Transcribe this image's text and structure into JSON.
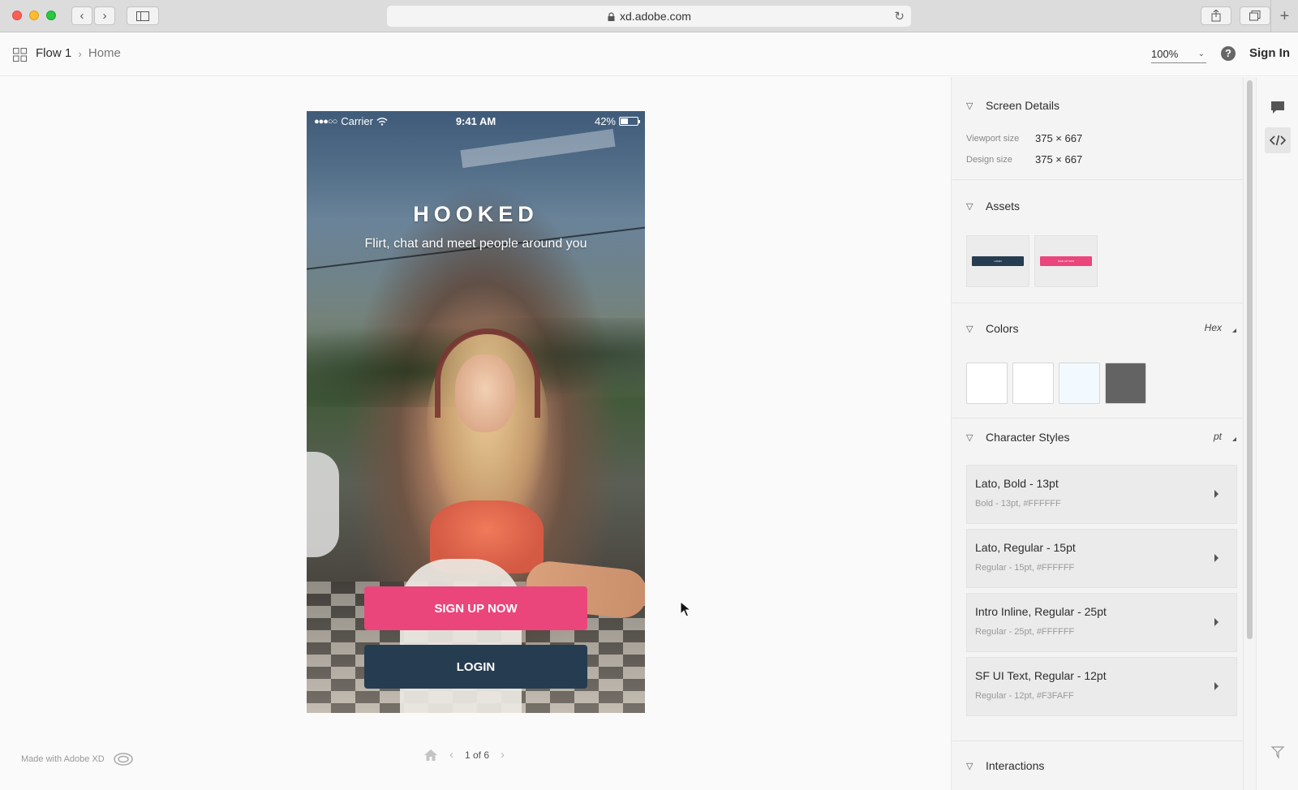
{
  "browser": {
    "url": "xd.adobe.com"
  },
  "header": {
    "breadcrumb": [
      "Flow 1",
      "Home"
    ],
    "zoom": "100%",
    "sign_in": "Sign In",
    "help": "?"
  },
  "phone": {
    "status": {
      "carrier": "Carrier",
      "time": "9:41 AM",
      "battery": "42%"
    },
    "brand": "HOOKED",
    "tagline": "Flirt, chat and meet people around you",
    "signup": "SIGN UP NOW",
    "login": "LOGIN"
  },
  "footer": {
    "made_with": "Made with Adobe XD",
    "page_indicator": "1 of 6"
  },
  "panel": {
    "screen_details": {
      "title": "Screen Details",
      "viewport_label": "Viewport size",
      "viewport_value": "375 × 667",
      "design_label": "Design size",
      "design_value": "375 × 667"
    },
    "assets": {
      "title": "Assets",
      "items": [
        {
          "label": "LOGIN",
          "color": "#263c50"
        },
        {
          "label": "SIGN UP NOW",
          "color": "#ea467c"
        }
      ]
    },
    "colors": {
      "title": "Colors",
      "format": "Hex",
      "swatches": [
        "#ffffff",
        "#ffffff",
        "#f3faff",
        "#636363"
      ]
    },
    "character_styles": {
      "title": "Character Styles",
      "unit": "pt",
      "items": [
        {
          "name": "Lato, Bold - 13pt",
          "detail": "Bold - 13pt, #FFFFFF"
        },
        {
          "name": "Lato, Regular - 15pt",
          "detail": "Regular - 15pt, #FFFFFF"
        },
        {
          "name": "Intro Inline, Regular - 25pt",
          "detail": "Regular - 25pt, #FFFFFF"
        },
        {
          "name": "SF UI Text, Regular - 12pt",
          "detail": "Regular - 12pt, #F3FAFF"
        }
      ]
    },
    "interactions": {
      "title": "Interactions"
    }
  }
}
